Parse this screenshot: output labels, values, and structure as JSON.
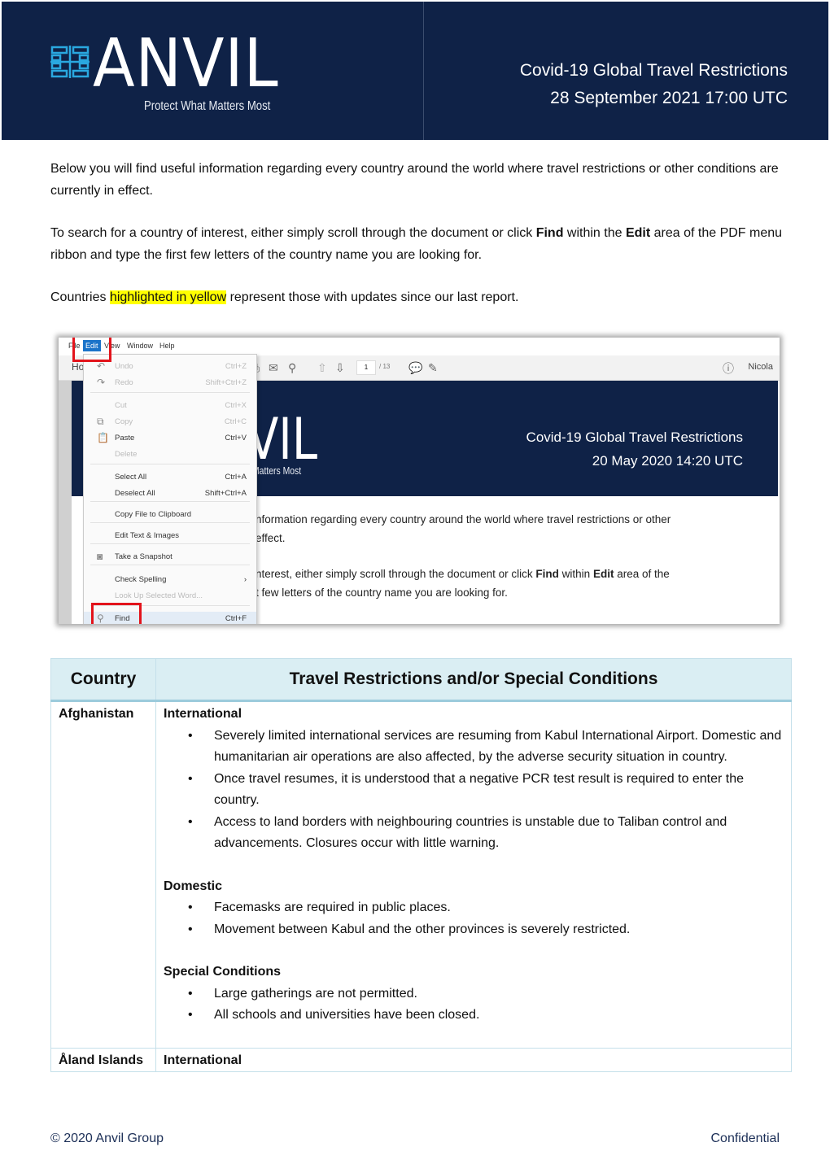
{
  "header": {
    "logo_word": "ANVIL",
    "logo_tagline": "Protect What Matters Most",
    "title": "Covid-19 Global Travel Restrictions",
    "timestamp": "28 September 2021 17:00 UTC",
    "colors": {
      "background": "#0f2247",
      "logo_mark": "#2aa8e0"
    }
  },
  "intro": {
    "p1": "Below you will find useful information regarding every country around the world where travel restrictions or other conditions are currently in effect.",
    "p2_a": "To search for a country of interest, either simply scroll through the document or click ",
    "p2_find": "Find",
    "p2_b": " within the ",
    "p2_edit": "Edit",
    "p2_c": " area of the PDF menu ribbon and type the first few letters of the country name you are looking for.",
    "p3_a": "Countries ",
    "p3_highlight": "highlighted in yellow",
    "p3_b": " represent those with updates since our last report."
  },
  "screenshot": {
    "menubar": [
      "File",
      "Edit",
      "View",
      "Window",
      "Help"
    ],
    "home_tab": "Ho",
    "page_current": "1",
    "page_total": "/ 13",
    "user": "Nicola",
    "edit_menu": [
      {
        "label": "Undo",
        "shortcut": "Ctrl+Z",
        "disabled": true,
        "icon": "undo-icon"
      },
      {
        "label": "Redo",
        "shortcut": "Shift+Ctrl+Z",
        "disabled": true,
        "icon": "redo-icon"
      },
      {
        "label": "Cut",
        "shortcut": "Ctrl+X",
        "disabled": true
      },
      {
        "label": "Copy",
        "shortcut": "Ctrl+C",
        "disabled": true,
        "icon": "copy-icon"
      },
      {
        "label": "Paste",
        "shortcut": "Ctrl+V",
        "disabled": false,
        "icon": "paste-icon"
      },
      {
        "label": "Delete",
        "shortcut": "",
        "disabled": true
      },
      {
        "label": "Select All",
        "shortcut": "Ctrl+A",
        "disabled": false
      },
      {
        "label": "Deselect All",
        "shortcut": "Shift+Ctrl+A",
        "disabled": false
      },
      {
        "label": "Copy File to Clipboard",
        "shortcut": "",
        "disabled": false
      },
      {
        "label": "Edit Text & Images",
        "shortcut": "",
        "disabled": false
      },
      {
        "label": "Take a Snapshot",
        "shortcut": "",
        "disabled": false,
        "icon": "camera-icon"
      },
      {
        "label": "Check Spelling",
        "shortcut": "›",
        "disabled": false
      },
      {
        "label": "Look Up Selected Word...",
        "shortcut": "",
        "disabled": true
      },
      {
        "label": "Find",
        "shortcut": "Ctrl+F",
        "disabled": false,
        "icon": "search-icon"
      }
    ],
    "doc_word": "VIL",
    "doc_tag": "Matters Most",
    "doc_title": "Covid-19 Global Travel Restrictions",
    "doc_timestamp": "20 May 2020 14:20 UTC",
    "doc_line1": "nformation regarding every country around the world where travel restrictions or other",
    "doc_line2": "effect.",
    "doc_line3_a": "nterest, either simply scroll through the document or click ",
    "doc_line3_find": "Find",
    "doc_line3_b": " within ",
    "doc_line3_edit": "Edit",
    "doc_line3_c": " area of the",
    "doc_line4": "t few letters of the country name you are looking for."
  },
  "table": {
    "col_country": "Country",
    "col_restrictions": "Travel Restrictions and/or Special Conditions",
    "rows": [
      {
        "country": "Afghanistan",
        "sections": [
          {
            "title": "International",
            "items": [
              "Severely limited international services are resuming from Kabul International Airport. Domestic and humanitarian air operations are also affected, by the adverse security situation in country.",
              "Once travel resumes, it is understood that a negative PCR test result is required to enter the country.",
              "Access to land borders with neighbouring countries is unstable due to Taliban control and advancements. Closures occur with little warning."
            ]
          },
          {
            "title": "Domestic",
            "items": [
              "Facemasks are required in public places.",
              "Movement between Kabul and the other provinces is severely restricted."
            ]
          },
          {
            "title": "Special Conditions",
            "items": [
              "Large gatherings are not permitted.",
              "All schools and universities have been closed."
            ]
          }
        ]
      },
      {
        "country": "Åland Islands",
        "sections": [
          {
            "title": "International",
            "items": []
          }
        ]
      }
    ]
  },
  "footer": {
    "copyright": "© 2020 Anvil Group",
    "classification": "Confidential"
  }
}
